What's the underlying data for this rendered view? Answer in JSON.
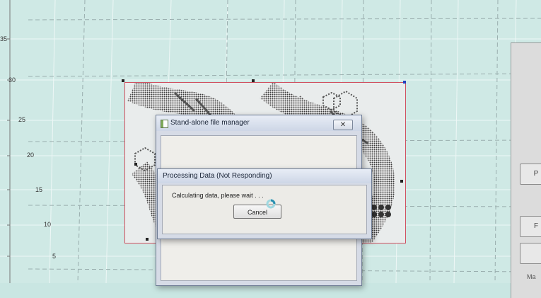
{
  "axis": {
    "y_ticks": [
      "35",
      "30",
      "25",
      "20",
      "15",
      "10",
      "5"
    ]
  },
  "file_manager_window": {
    "title": "Stand-alone file manager",
    "close_glyph": "✕"
  },
  "processing_dialog": {
    "title": "Processing Data (Not Responding)",
    "message": "Calculating data, please wait . . .",
    "cancel_label": "Cancel"
  },
  "side_panel": {
    "button_labels": [
      "P",
      "F",
      ""
    ],
    "bottom_label": "Ma"
  },
  "icons": {
    "app": "window-app-icon",
    "busy": "busy-spinner-icon",
    "close": "close-icon"
  },
  "colors": {
    "canvas": "#cfe9e5",
    "selection_border": "#d05060",
    "dialog_frame": "#6e7c94"
  }
}
